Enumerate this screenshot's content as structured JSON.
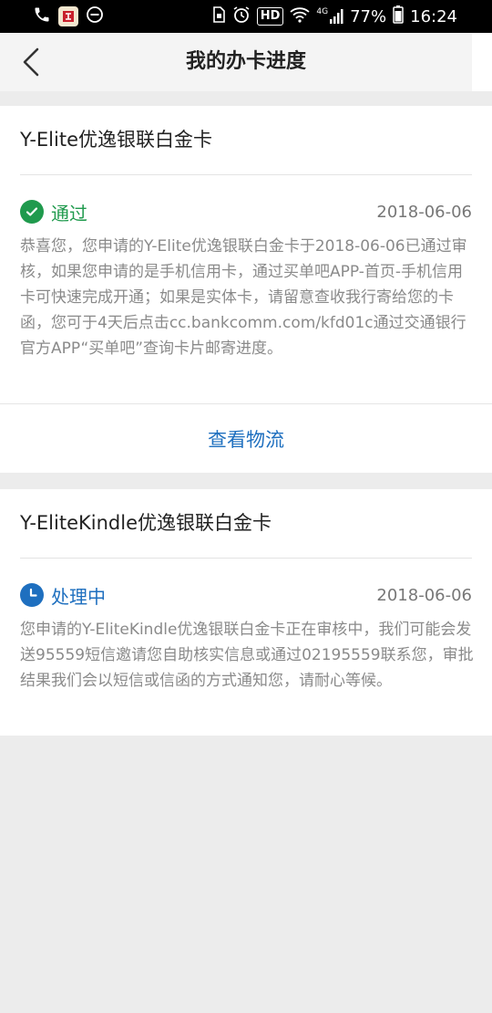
{
  "status_bar": {
    "time": "16:24",
    "battery": "77%",
    "hd": "HD",
    "network": "4G"
  },
  "nav": {
    "title": "我的办卡进度"
  },
  "colors": {
    "approved": "#1f9a4d",
    "processing": "#1e6fbf",
    "link": "#1e6fbf"
  },
  "applications": [
    {
      "card_name": "Y-Elite优逸银联白金卡",
      "status": "通过",
      "status_icon": "check-circle-icon",
      "date": "2018-06-06",
      "description": "恭喜您，您申请的Y-Elite优逸银联白金卡于2018-06-06已通过审核，如果您申请的是手机信用卡，通过买单吧APP-首页-手机信用卡可快速完成开通；如果是实体卡，请留意查收我行寄给您的卡函，您可于4天后点击cc.bankcomm.com/kfd01c通过交通银行官方APP“买单吧”查询卡片邮寄进度。",
      "action": "查看物流"
    },
    {
      "card_name": "Y-EliteKindle优逸银联白金卡",
      "status": "处理中",
      "status_icon": "clock-icon",
      "date": "2018-06-06",
      "description": "您申请的Y-EliteKindle优逸银联白金卡正在审核中，我们可能会发送95559短信邀请您自助核实信息或通过02195559联系您，审批结果我们会以短信或信函的方式通知您，请耐心等候。"
    }
  ]
}
